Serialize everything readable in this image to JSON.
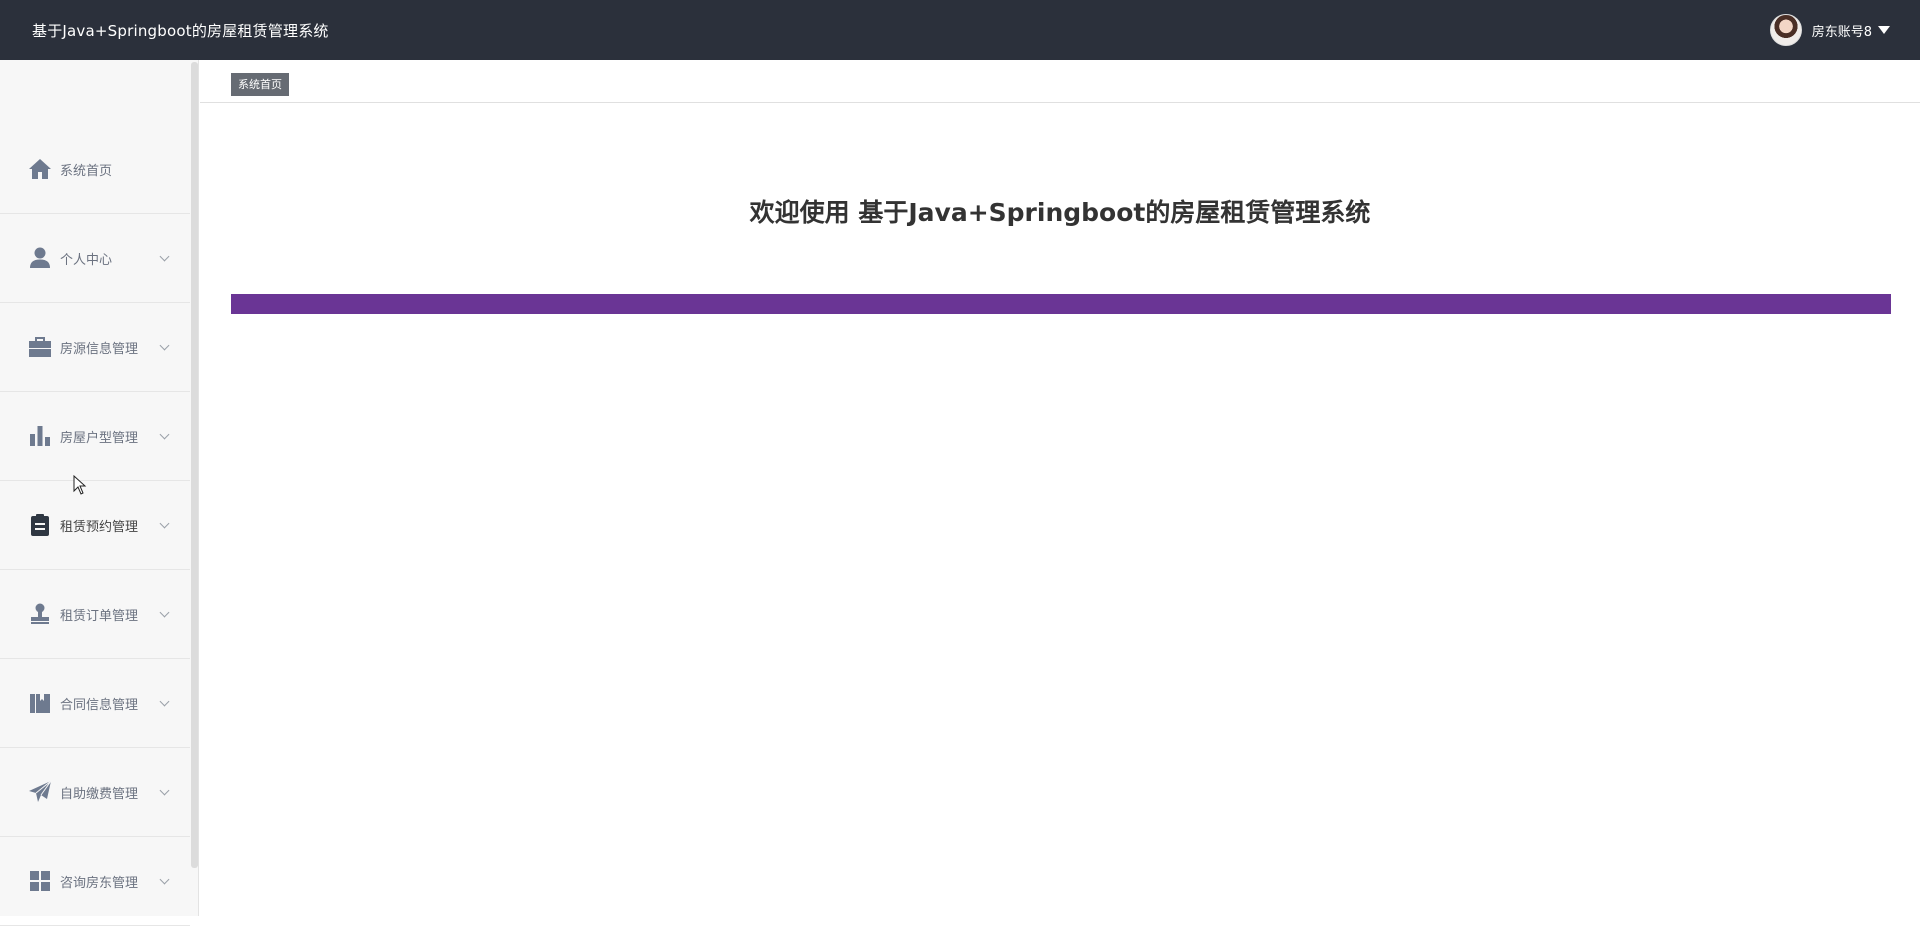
{
  "header": {
    "app_title": "基于Java+Springboot的房屋租赁管理系统",
    "user_name": "房东账号8"
  },
  "sidebar": {
    "items": [
      {
        "label": "系统首页",
        "icon": "home-icon",
        "expandable": false
      },
      {
        "label": "个人中心",
        "icon": "user-icon",
        "expandable": true
      },
      {
        "label": "房源信息管理",
        "icon": "briefcase-icon",
        "expandable": true
      },
      {
        "label": "房屋户型管理",
        "icon": "bar-chart-icon",
        "expandable": true
      },
      {
        "label": "租赁预约管理",
        "icon": "clipboard-icon",
        "expandable": true
      },
      {
        "label": "租赁订单管理",
        "icon": "stamp-icon",
        "expandable": true
      },
      {
        "label": "合同信息管理",
        "icon": "book-icon",
        "expandable": true
      },
      {
        "label": "自助缴费管理",
        "icon": "paper-plane-icon",
        "expandable": true
      },
      {
        "label": "咨询房东管理",
        "icon": "grid-icon",
        "expandable": true
      }
    ]
  },
  "tabs": {
    "active_label": "系统首页"
  },
  "main": {
    "welcome_text": "欢迎使用 基于Java+Springboot的房屋租赁管理系统"
  },
  "colors": {
    "topbar_bg": "#2b303b",
    "accent_bar": "#6a3595",
    "icon_color": "#6e7a8f"
  }
}
